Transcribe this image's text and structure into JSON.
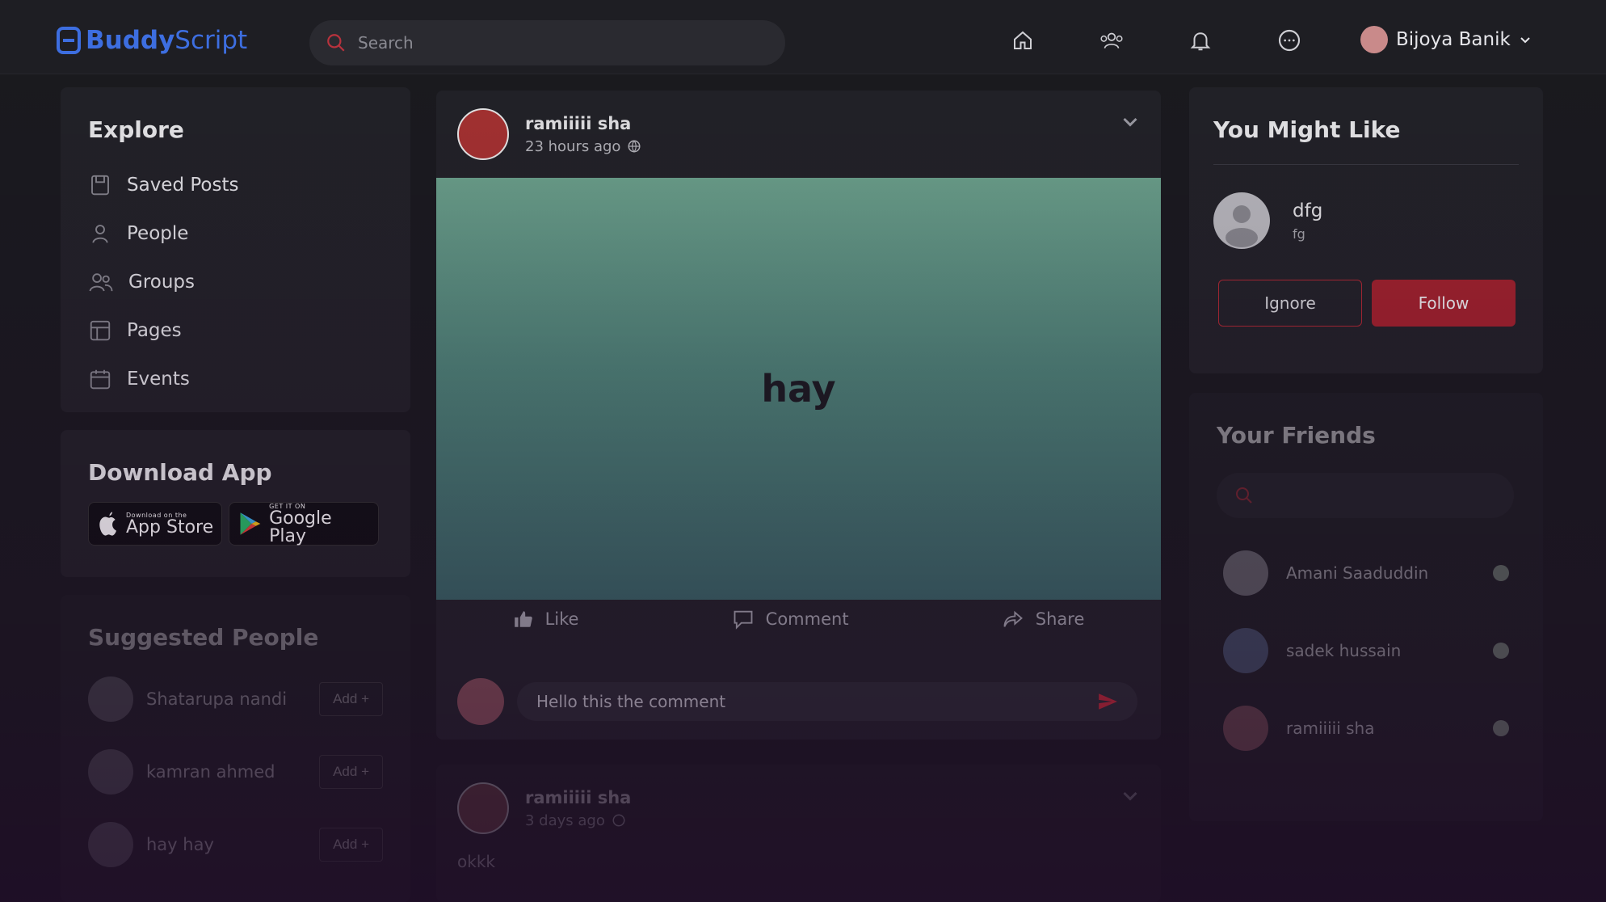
{
  "app": {
    "brand_bold": "Buddy",
    "brand_light": "Script"
  },
  "search": {
    "placeholder": "Search"
  },
  "user": {
    "name": "Bijoya Banik"
  },
  "explore": {
    "title": "Explore",
    "items": [
      {
        "label": "Saved Posts",
        "icon": "bookmark-icon"
      },
      {
        "label": "People",
        "icon": "person-icon"
      },
      {
        "label": "Groups",
        "icon": "groups-icon"
      },
      {
        "label": "Pages",
        "icon": "pages-icon"
      },
      {
        "label": "Events",
        "icon": "calendar-icon"
      }
    ]
  },
  "download": {
    "title": "Download App",
    "appstore_small": "Download on the",
    "appstore_big": "App Store",
    "googleplay_small": "GET IT ON",
    "googleplay_big": "Google Play"
  },
  "suggested": {
    "title": "Suggested People",
    "add_label": "Add +",
    "people": [
      {
        "name": "Shatarupa nandi"
      },
      {
        "name": "kamran ahmed"
      },
      {
        "name": "hay hay"
      }
    ]
  },
  "post": {
    "author": "ramiiiii sha",
    "time": "23 hours ago",
    "text": "hay",
    "like_label": "Like",
    "comment_label": "Comment",
    "share_label": "Share",
    "comment_value": "Hello this the comment"
  },
  "post2": {
    "author": "ramiiiii sha",
    "time": "3 days ago",
    "text": "okkk"
  },
  "might_like": {
    "title": "You Might Like",
    "name": "dfg",
    "sub": "fg",
    "ignore_label": "Ignore",
    "follow_label": "Follow"
  },
  "friends": {
    "title": "Your Friends",
    "list": [
      {
        "name": "Amani Saaduddin"
      },
      {
        "name": "sadek hussain"
      },
      {
        "name": "ramiiiii sha"
      }
    ]
  },
  "colors": {
    "accent": "#a3232e",
    "brand": "#3d6ee0"
  }
}
